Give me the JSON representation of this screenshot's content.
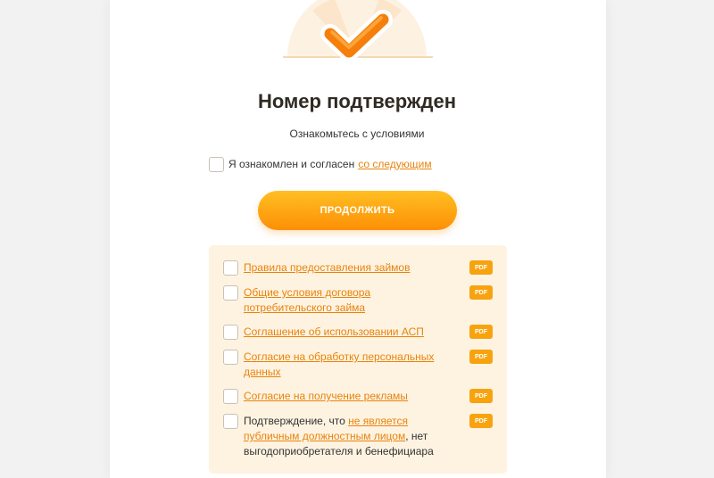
{
  "page": {
    "title": "Номер подтвержден",
    "subtitle": "Ознакомьтесь с условиями"
  },
  "agreement": {
    "prefix": "Я ознакомлен и согласен",
    "link": "со следующим",
    "checked": false
  },
  "continue_button": "ПРОДОЛЖИТЬ",
  "documents": [
    {
      "link": "Правила предоставления займов",
      "badge": "PDF"
    },
    {
      "link": "Общие условия договора потребительского займа",
      "badge": "PDF"
    },
    {
      "link": "Соглашение об использовании АСП",
      "badge": "PDF"
    },
    {
      "link": "Согласие на обработку персональных данных",
      "badge": "PDF"
    },
    {
      "link": "Согласие на получение рекламы",
      "badge": "PDF"
    },
    {
      "prefix": "Подтверждение, что",
      "link": "не является публичным должностным лицом",
      "suffix": ", нет выгодоприобретателя и бенефициара",
      "badge": "PDF"
    }
  ],
  "colors": {
    "accent": "#fd8f06",
    "link": "#e8830c",
    "panel": "#fef3e1",
    "badge": "#f7a30f"
  },
  "icons": {
    "hero": "checkmark-icon"
  }
}
